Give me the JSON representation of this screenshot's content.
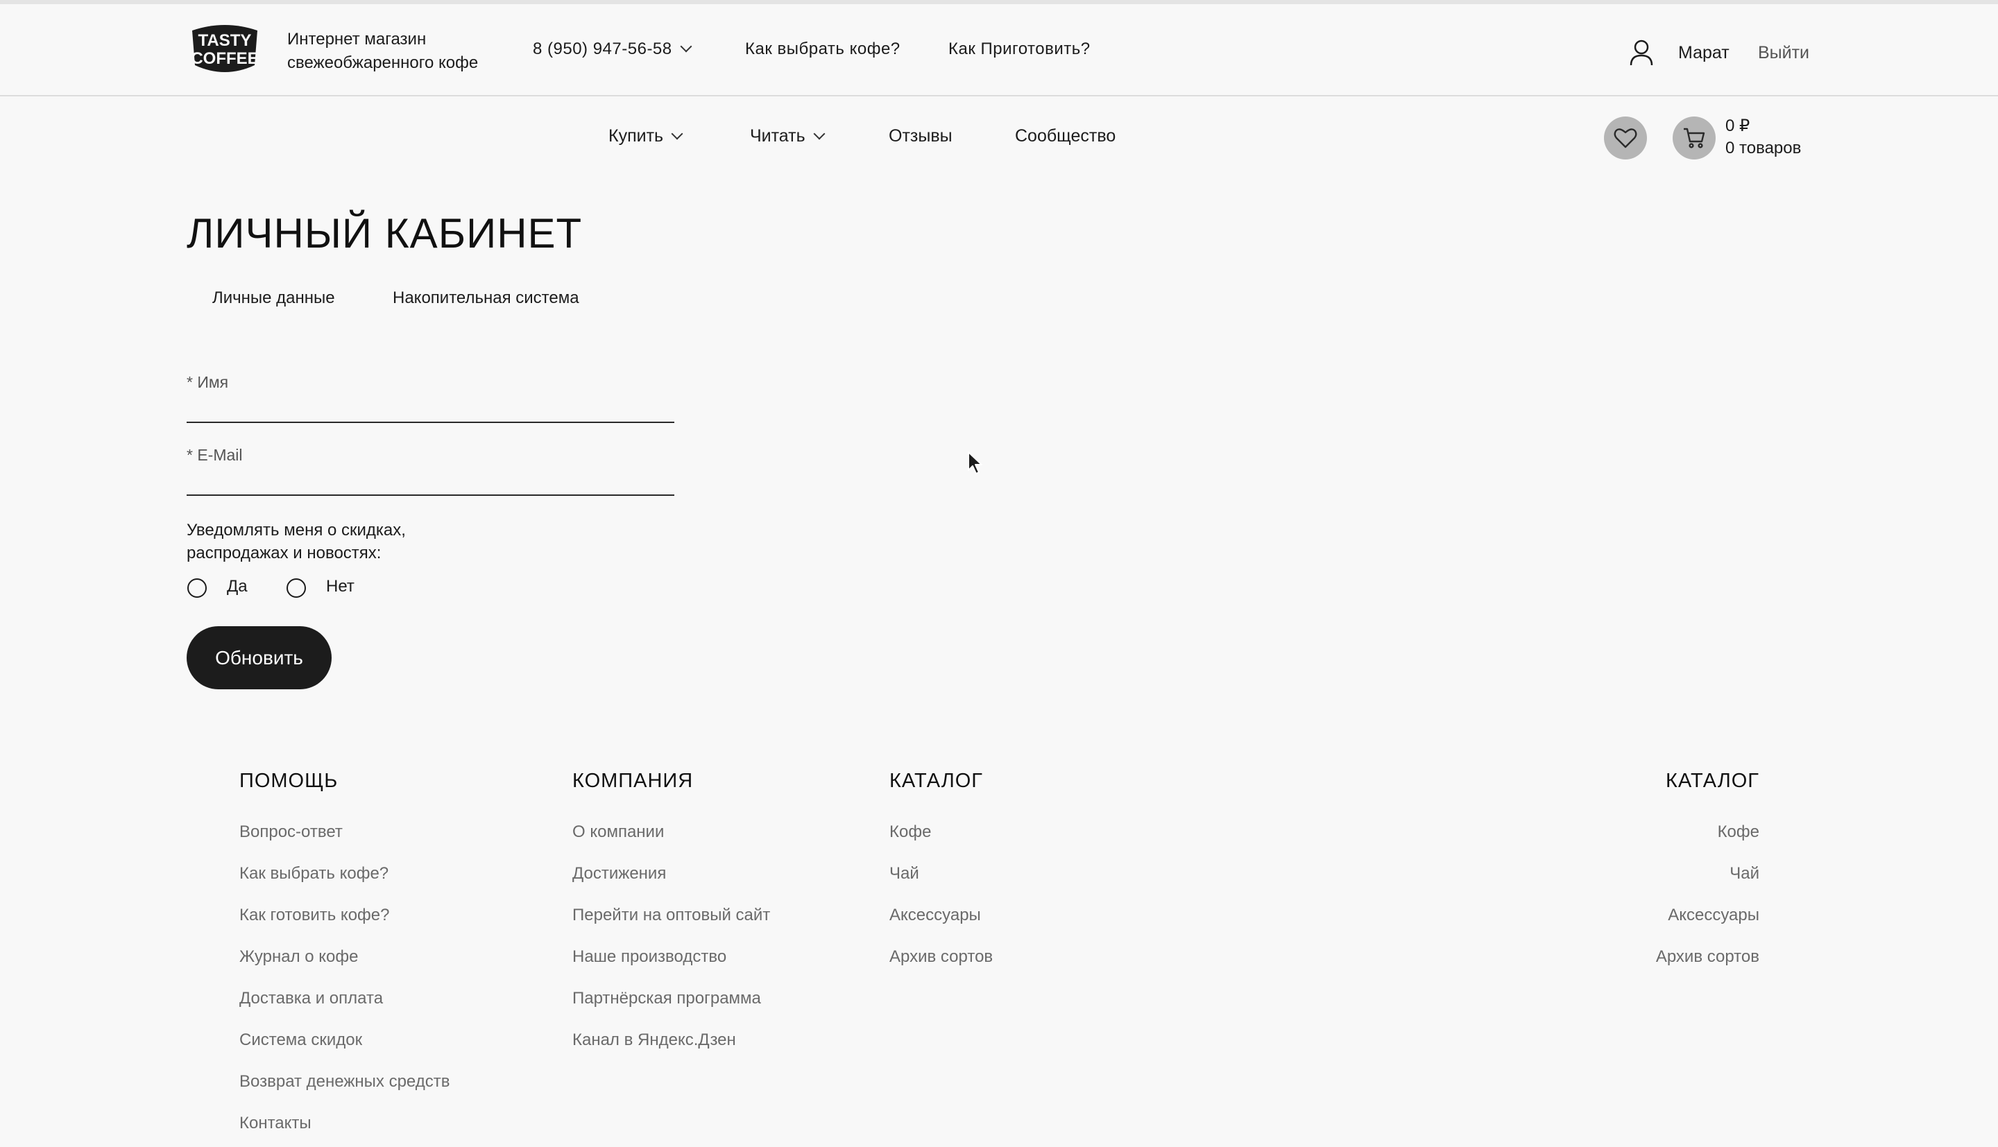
{
  "header": {
    "tagline_line1": "Интернет магазин",
    "tagline_line2": "свежеобжаренного кофе",
    "phone": "8 (950) 947-56-58",
    "link_choose": "Как выбрать кофе?",
    "link_brew": "Как Приготовить?",
    "user_name": "Марат",
    "logout": "Выйти"
  },
  "nav": {
    "buy": "Купить",
    "read": "Читать",
    "reviews": "Отзывы",
    "community": "Сообщество",
    "cart_sum": "0 ₽",
    "cart_count": "0 товаров"
  },
  "page": {
    "title": "ЛИЧНЫЙ КАБИНЕТ",
    "tabs": [
      "Личные данные",
      "Накопительная система"
    ]
  },
  "form": {
    "name_label": "* Имя",
    "email_label": "* E-Mail",
    "notify_line1": "Уведомлять меня о скидках,",
    "notify_line2": "распродажах и новостях:",
    "yes": "Да",
    "no": "Нет",
    "submit": "Обновить"
  },
  "footer": {
    "help": {
      "title": "ПОМОЩЬ",
      "links": [
        "Вопрос-ответ",
        "Как выбрать кофе?",
        "Как готовить кофе?",
        "Журнал о кофе",
        "Доставка и оплата",
        "Система скидок",
        "Возврат денежных средств",
        "Контакты"
      ]
    },
    "company": {
      "title": "КОМПАНИЯ",
      "links": [
        "О компании",
        "Достижения",
        "Перейти на оптовый сайт",
        "Наше производство",
        "Партнёрская программа",
        "Канал в Яндекс.Дзен"
      ]
    },
    "catalog": {
      "title": "КАТАЛОГ",
      "links": [
        "Кофе",
        "Чай",
        "Аксессуары",
        "Архив сортов"
      ]
    },
    "catalog_right": {
      "title": "КАТАЛОГ",
      "links": [
        "Кофе",
        "Чай",
        "Аксессуары",
        "Архив сортов"
      ]
    }
  },
  "colors": {
    "background": "#f8f8f8",
    "text": "#1c1c1c",
    "button_dark": "#1c1c1c",
    "icon_circle": "#b5b5b5",
    "muted_link": "#6a6a6a"
  },
  "icons": {
    "logo": "tasty-coffee-logo",
    "user": "user-icon",
    "favorites": "heart-icon",
    "cart": "cart-icon",
    "dropdown": "chevron-down-icon",
    "pointer": "mouse-cursor"
  }
}
